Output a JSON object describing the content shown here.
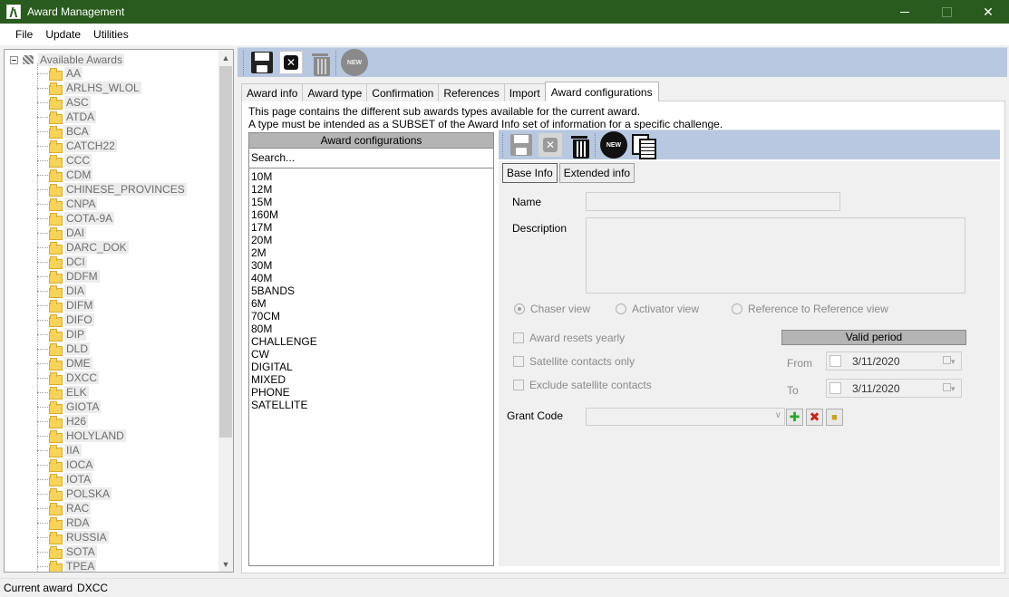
{
  "window": {
    "title": "Award Management"
  },
  "menu": [
    "File",
    "Update",
    "Utilities"
  ],
  "tree": {
    "root": "Available Awards",
    "items": [
      "AA",
      "ARLHS_WLOL",
      "ASC",
      "ATDA",
      "BCA",
      "CATCH22",
      "CCC",
      "CDM",
      "CHINESE_PROVINCES",
      "CNPA",
      "COTA-9A",
      "DAI",
      "DARC_DOK",
      "DCI",
      "DDFM",
      "DIA",
      "DIFM",
      "DIFO",
      "DIP",
      "DLD",
      "DME",
      "DXCC",
      "ELK",
      "GIOTA",
      "H26",
      "HOLYLAND",
      "IIA",
      "IOCA",
      "IOTA",
      "POLSKA",
      "RAC",
      "RDA",
      "RUSSIA",
      "SOTA",
      "TPEA"
    ]
  },
  "main_toolbar": {
    "new_label": "NEW"
  },
  "tabs": [
    "Award info",
    "Award type",
    "Confirmation",
    "References",
    "Import",
    "Award configurations"
  ],
  "active_tab": "Award configurations",
  "description": [
    "This page contains the different sub awards types available for the current award.",
    "A type must be intended as a SUBSET of the Award Info set of information for a specific challenge."
  ],
  "config_list": {
    "header": "Award configurations",
    "search_placeholder": "Search...",
    "items": [
      "10M",
      "12M",
      "15M",
      "160M",
      "17M",
      "20M",
      "2M",
      "30M",
      "40M",
      "5BANDS",
      "6M",
      "70CM",
      "80M",
      "CHALLENGE",
      "CW",
      "DIGITAL",
      "MIXED",
      "PHONE",
      "SATELLITE"
    ]
  },
  "detail_toolbar": {
    "new_label": "NEW"
  },
  "sub_tabs": [
    "Base Info",
    "Extended info"
  ],
  "form": {
    "name_label": "Name",
    "description_label": "Description",
    "radios": [
      "Chaser view",
      "Activator view",
      "Reference to Reference view"
    ],
    "checks": [
      "Award resets yearly",
      "Satellite contacts only",
      "Exclude satellite contacts"
    ],
    "valid_period": "Valid period",
    "from_label": "From",
    "to_label": "To",
    "from_date": "3/11/2020",
    "to_date": "3/11/2020",
    "grant_code_label": "Grant Code"
  },
  "status": {
    "label": "Current award",
    "value": "DXCC"
  }
}
